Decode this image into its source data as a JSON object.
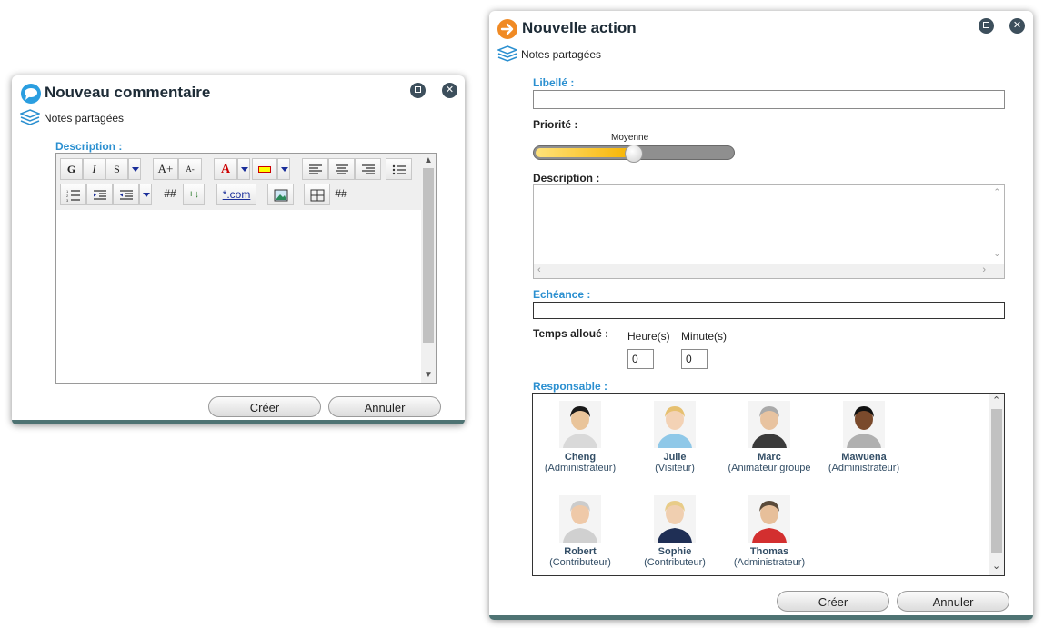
{
  "comment_dialog": {
    "title": "Nouveau commentaire",
    "subtitle": "Notes partagées",
    "description_label": "Description :",
    "toolbar": {
      "bold": "G",
      "italic": "I",
      "underline": "S",
      "font_bigger": "A+",
      "font_smaller": "A-",
      "numbering": "##",
      "insert": "+↓",
      "link": "*.com",
      "anchor": "##"
    },
    "create_label": "Créer",
    "cancel_label": "Annuler"
  },
  "action_dialog": {
    "title": "Nouvelle action",
    "subtitle": "Notes partagées",
    "libelle_label": "Libellé :",
    "priority_label": "Priorité :",
    "priority_value": "Moyenne",
    "priority_level": 0.5,
    "description_label": "Description :",
    "echeance_label": "Echéance :",
    "time_label": "Temps alloué :",
    "hours_label": "Heure(s)",
    "minutes_label": "Minute(s)",
    "hours_value": "0",
    "minutes_value": "0",
    "responsable_label": "Responsable :",
    "people": [
      {
        "name": "Cheng",
        "role": "(Administrateur)"
      },
      {
        "name": "Julie",
        "role": "(Visiteur)"
      },
      {
        "name": "Marc",
        "role": "(Animateur groupe"
      },
      {
        "name": "Mawuena",
        "role": "(Administrateur)"
      },
      {
        "name": "Robert",
        "role": "(Contributeur)"
      },
      {
        "name": "Sophie",
        "role": "(Contributeur)"
      },
      {
        "name": "Thomas",
        "role": "(Administrateur)"
      }
    ],
    "create_label": "Créer",
    "cancel_label": "Annuler"
  }
}
